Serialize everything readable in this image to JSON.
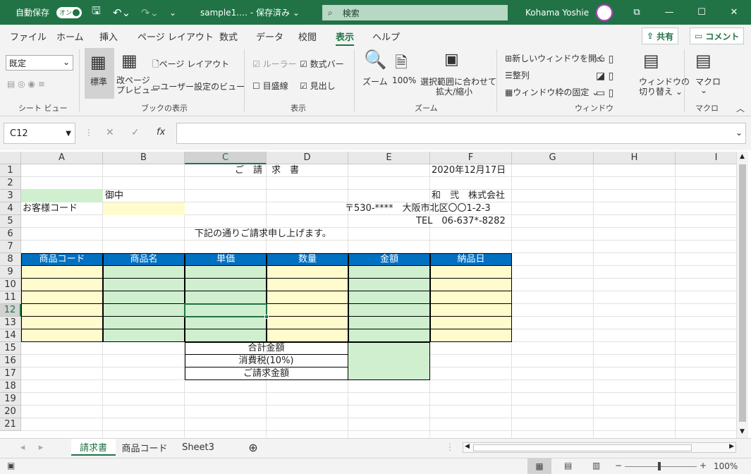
{
  "titlebar": {
    "autosave": "自動保存",
    "toggle": "オン",
    "filename": "sample1.…  - 保存済み ⌄",
    "search": "検索",
    "user": "Kohama Yoshie",
    "colors": {
      "bg": "#217346"
    }
  },
  "tabs": [
    "ファイル",
    "ホーム",
    "挿入",
    "ページ レイアウト",
    "数式",
    "データ",
    "校閲",
    "表示",
    "ヘルプ"
  ],
  "share": "共有",
  "comment": "コメント",
  "ribbon": {
    "sheetview_select": "既定",
    "normal": "標準",
    "pagebreak": "改ページ\nプレビュー",
    "pagelayout": "ページ レイアウト",
    "customview": "ユーザー設定のビュー",
    "ruler": "ルーラー",
    "formulabar": "数式バー",
    "gridlines": "目盛線",
    "headings": "見出し",
    "zoom": "ズーム",
    "zoom100": "100%",
    "zoomsel": "選択範囲に合わせて",
    "zoomsel2": "拡大/縮小",
    "newwin": "新しいウィンドウを開く",
    "arrange": "整列",
    "freeze": "ウィンドウ枠の固定 ⌄",
    "switchwin": "ウィンドウの",
    "switchwin2": "切り替え ⌄",
    "macro": "マクロ",
    "groups": [
      "シート ビュー",
      "ブックの表示",
      "表示",
      "ズーム",
      "ウィンドウ",
      "マクロ"
    ]
  },
  "formula": {
    "namebox": "C12",
    "fx": "fx"
  },
  "columns": [
    "A",
    "B",
    "C",
    "D",
    "E",
    "F",
    "G",
    "H",
    "I"
  ],
  "rows": [
    "1",
    "2",
    "3",
    "4",
    "5",
    "6",
    "7",
    "8",
    "9",
    "10",
    "11",
    "12",
    "13",
    "14",
    "15",
    "16",
    "17",
    "18",
    "19",
    "20",
    "21"
  ],
  "sheet": {
    "title": "ご　請　求　書",
    "date": "2020年12月17日",
    "onchu": "御中",
    "company": "和　弐　株式会社",
    "customer_code": "お客様コード",
    "address": "〒530-****　大阪市北区〇〇1-2-3",
    "tel": "TEL　06-637*-8282",
    "greeting": "下記の通りご請求申し上げます。",
    "headers": [
      "商品コード",
      "商品名",
      "単価",
      "数量",
      "金額",
      "納品日"
    ],
    "subtotal": "合計金額",
    "tax": "消費税(10%)",
    "total": "ご請求金額"
  },
  "sheettabs": [
    "請求書",
    "商品コード",
    "Sheet3"
  ],
  "status": {
    "zoom": "100%"
  }
}
